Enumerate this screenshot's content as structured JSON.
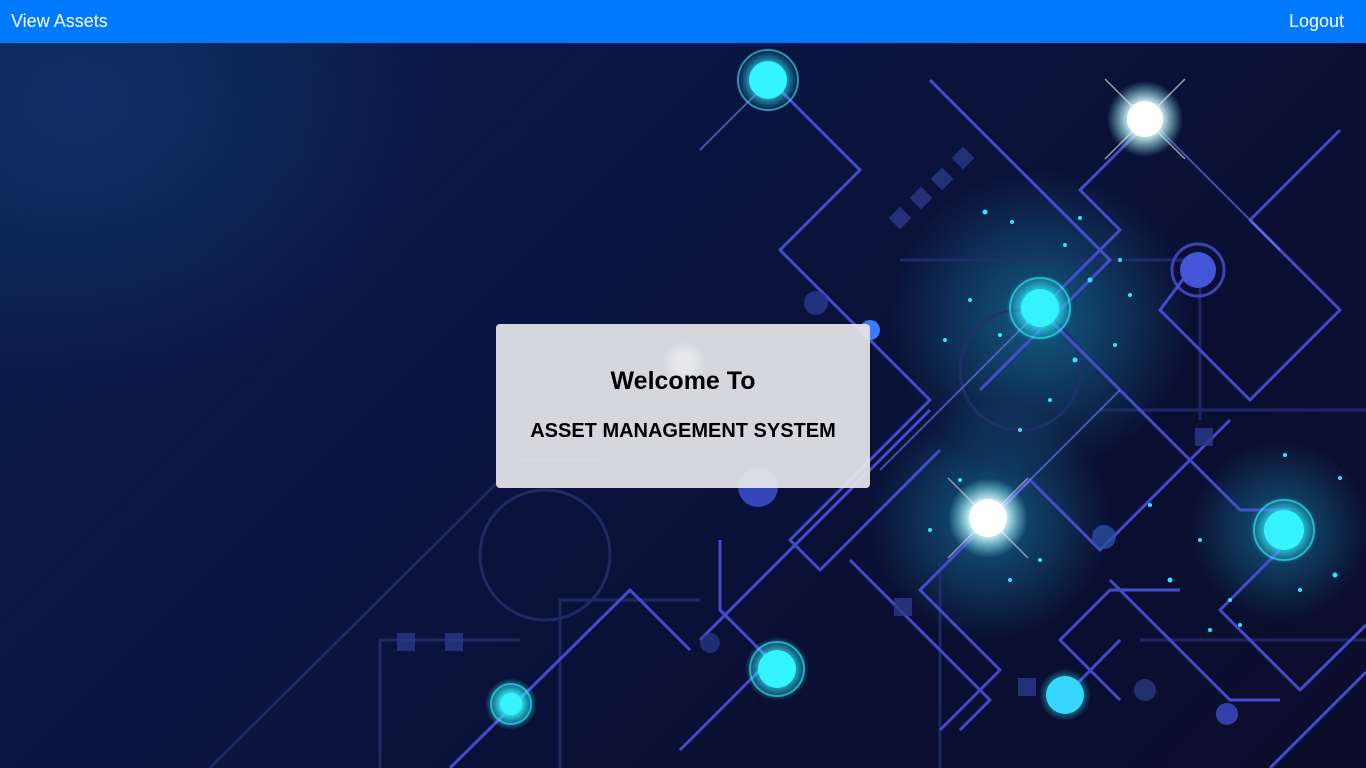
{
  "navbar": {
    "left_link": "View Assets",
    "right_link": "Logout"
  },
  "welcome": {
    "title": "Welcome To",
    "subtitle": "ASSET MANAGEMENT SYSTEM"
  },
  "colors": {
    "navbar": "#007bff",
    "background": "#0b1130",
    "card": "#e6e6ea",
    "glow": "#2ff3ff",
    "line": "#5a5fe0"
  },
  "background_image": "circuit-network-graphic"
}
